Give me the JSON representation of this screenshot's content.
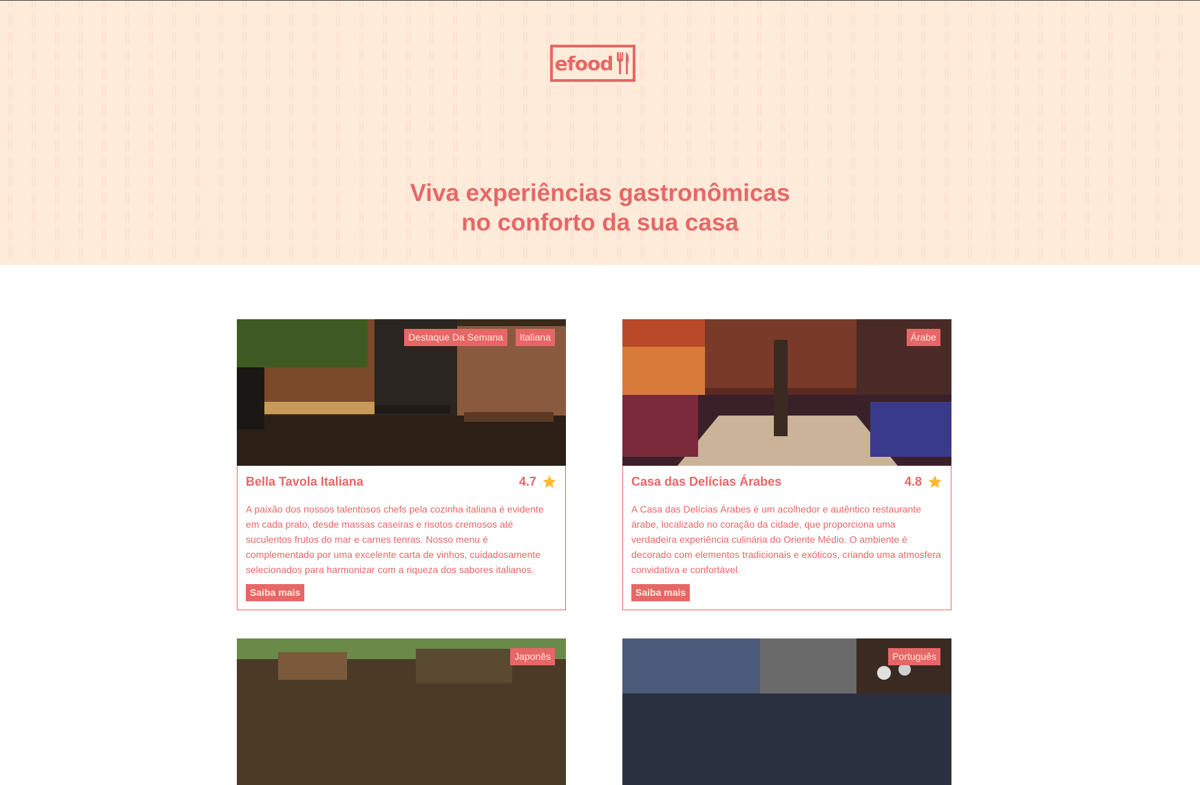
{
  "brand": {
    "logo_text": "efood"
  },
  "hero": {
    "title_line1": "Viva experiências gastronômicas",
    "title_line2": "no conforto da sua casa"
  },
  "restaurants": [
    {
      "name": "Bella Tavola Italiana",
      "rating": "4.7",
      "tags": [
        "Destaque Da Semana",
        "Italiana"
      ],
      "description": "A paixão dos nossos talentosos chefs pela cozinha italiana é evidente em cada prato, desde massas caseiras e risotos cremosos até suculentos frutos do mar e carnes tenras. Nosso menu é complementado por uma excelente carta de vinhos, cuidadosamente selecionados para harmonizar com a riqueza dos sabores italianos.",
      "button": "Saiba mais"
    },
    {
      "name": "Casa das Delícias Árabes",
      "rating": "4.8",
      "tags": [
        "Árabe"
      ],
      "description": "A Casa das Delícias Árabes é um acolhedor e autêntico restaurante árabe, localizado no coração da cidade, que proporciona uma verdadeira experiência culinária do Oriente Médio. O ambiente é decorado com elementos tradicionais e exóticos, criando uma atmosfera convidativa e confortável.",
      "button": "Saiba mais"
    },
    {
      "tags": [
        "Japonês"
      ]
    },
    {
      "tags": [
        "Português"
      ]
    }
  ],
  "colors": {
    "primary": "#E66767",
    "secondary": "#FFEBD9",
    "star": "#FFB930"
  }
}
